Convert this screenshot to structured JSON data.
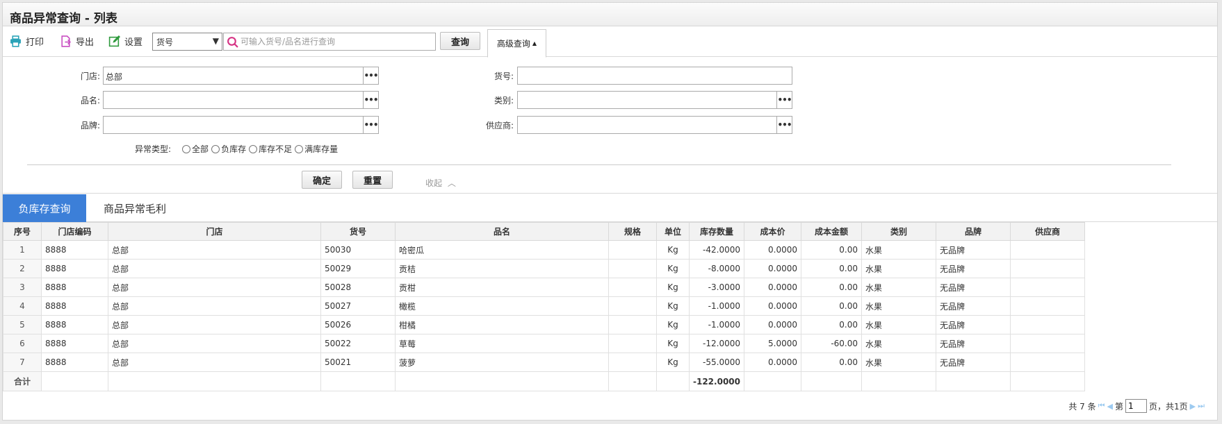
{
  "window": {
    "title": "商品异常查询 - 列表"
  },
  "toolbar": {
    "print_label": "打印",
    "export_label": "导出",
    "settings_label": "设置",
    "field_select": {
      "selected": "货号"
    },
    "search": {
      "placeholder": "可输入货号/品名进行查询",
      "value": ""
    },
    "query_label": "查询",
    "advanced_label": "高级查询"
  },
  "filter": {
    "store_label": "门店:",
    "store_value": "总部",
    "sku_label": "货号:",
    "name_label": "品名:",
    "category_label": "类别:",
    "brand_label": "品牌:",
    "supplier_label": "供应商:",
    "exception_label": "异常类型:",
    "options": [
      "全部",
      "负库存",
      "库存不足",
      "满库存量"
    ],
    "confirm_label": "确定",
    "reset_label": "重置",
    "collapse_label": "收起"
  },
  "tabs": [
    {
      "label": "负库存查询",
      "active": true
    },
    {
      "label": "商品异常毛利",
      "active": false
    }
  ],
  "table": {
    "headers": [
      "序号",
      "门店编码",
      "门店",
      "货号",
      "品名",
      "规格",
      "单位",
      "库存数量",
      "成本价",
      "成本金额",
      "类别",
      "品牌",
      "供应商"
    ],
    "rows": [
      [
        "1",
        "8888",
        "总部",
        "50030",
        "哈密瓜",
        "",
        "Kg",
        "-42.0000",
        "0.0000",
        "0.00",
        "水果",
        "无品牌",
        ""
      ],
      [
        "2",
        "8888",
        "总部",
        "50029",
        "贡桔",
        "",
        "Kg",
        "-8.0000",
        "0.0000",
        "0.00",
        "水果",
        "无品牌",
        ""
      ],
      [
        "3",
        "8888",
        "总部",
        "50028",
        "贡柑",
        "",
        "Kg",
        "-3.0000",
        "0.0000",
        "0.00",
        "水果",
        "无品牌",
        ""
      ],
      [
        "4",
        "8888",
        "总部",
        "50027",
        "橄榄",
        "",
        "Kg",
        "-1.0000",
        "0.0000",
        "0.00",
        "水果",
        "无品牌",
        ""
      ],
      [
        "5",
        "8888",
        "总部",
        "50026",
        "柑橘",
        "",
        "Kg",
        "-1.0000",
        "0.0000",
        "0.00",
        "水果",
        "无品牌",
        ""
      ],
      [
        "6",
        "8888",
        "总部",
        "50022",
        "草莓",
        "",
        "Kg",
        "-12.0000",
        "5.0000",
        "-60.00",
        "水果",
        "无品牌",
        ""
      ],
      [
        "7",
        "8888",
        "总部",
        "50021",
        "菠萝",
        "",
        "Kg",
        "-55.0000",
        "0.0000",
        "0.00",
        "水果",
        "无品牌",
        ""
      ]
    ],
    "total_label": "合计",
    "total_qty": "-122.0000"
  },
  "pager": {
    "total_text": "共 7 条",
    "page_prefix": "第",
    "page_value": "1",
    "page_suffix": "页，共1页"
  },
  "colors": {
    "accent": "#3c7fd8",
    "print_icon": "#2aa3b8",
    "export_icon": "#c94fc2",
    "settings_icon": "#2f9a3d",
    "search_icon": "#d63384"
  }
}
